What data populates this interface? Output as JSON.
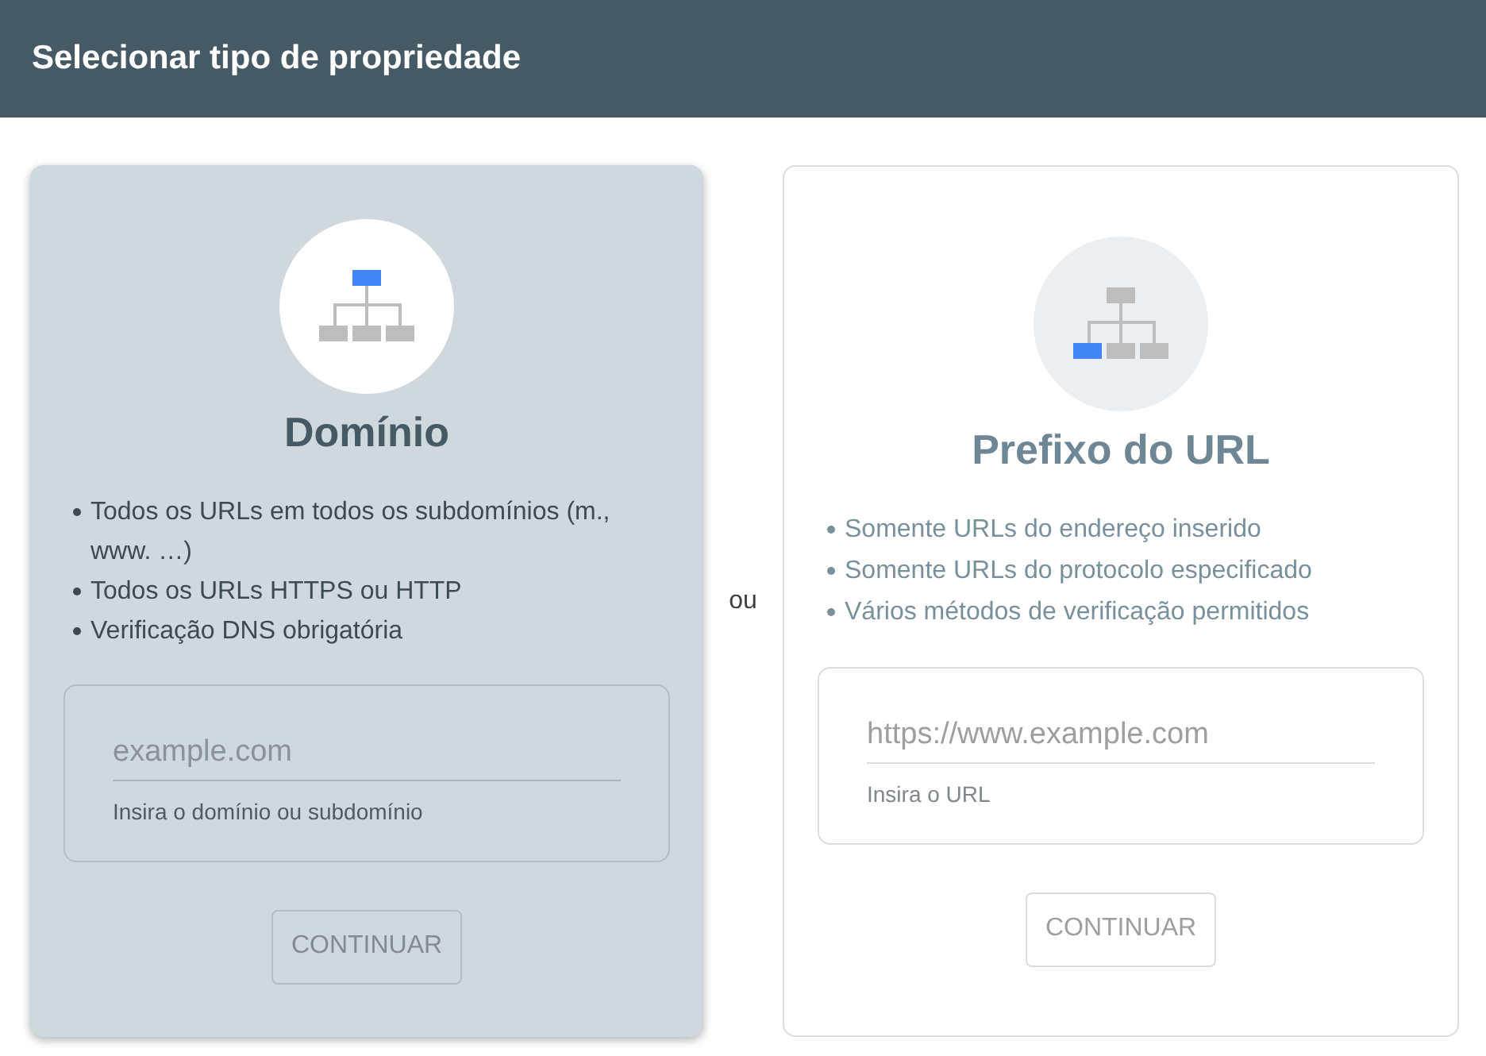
{
  "header": {
    "title": "Selecionar tipo de propriedade"
  },
  "options": [
    {
      "kind": "domain",
      "selected": true,
      "title": "Domínio",
      "bullets": [
        "Todos os URLs em todos os subdomínios (m., www. …)",
        "Todos os URLs HTTPS ou HTTP",
        "Verificação DNS obrigatória"
      ],
      "field": {
        "placeholder": "example.com",
        "helper": "Insira o domínio ou subdomínio"
      },
      "button": {
        "label": "CONTINUAR",
        "disabled": true
      }
    },
    {
      "kind": "url_prefix",
      "selected": false,
      "title": "Prefixo do URL",
      "bullets": [
        "Somente URLs do endereço inserido",
        "Somente URLs do protocolo especificado",
        "Vários métodos de verificação permitidos"
      ],
      "field": {
        "placeholder": "https://www.example.com",
        "helper": "Insira o URL"
      },
      "button": {
        "label": "CONTINUAR",
        "disabled": true
      }
    }
  ],
  "separator": "ou"
}
